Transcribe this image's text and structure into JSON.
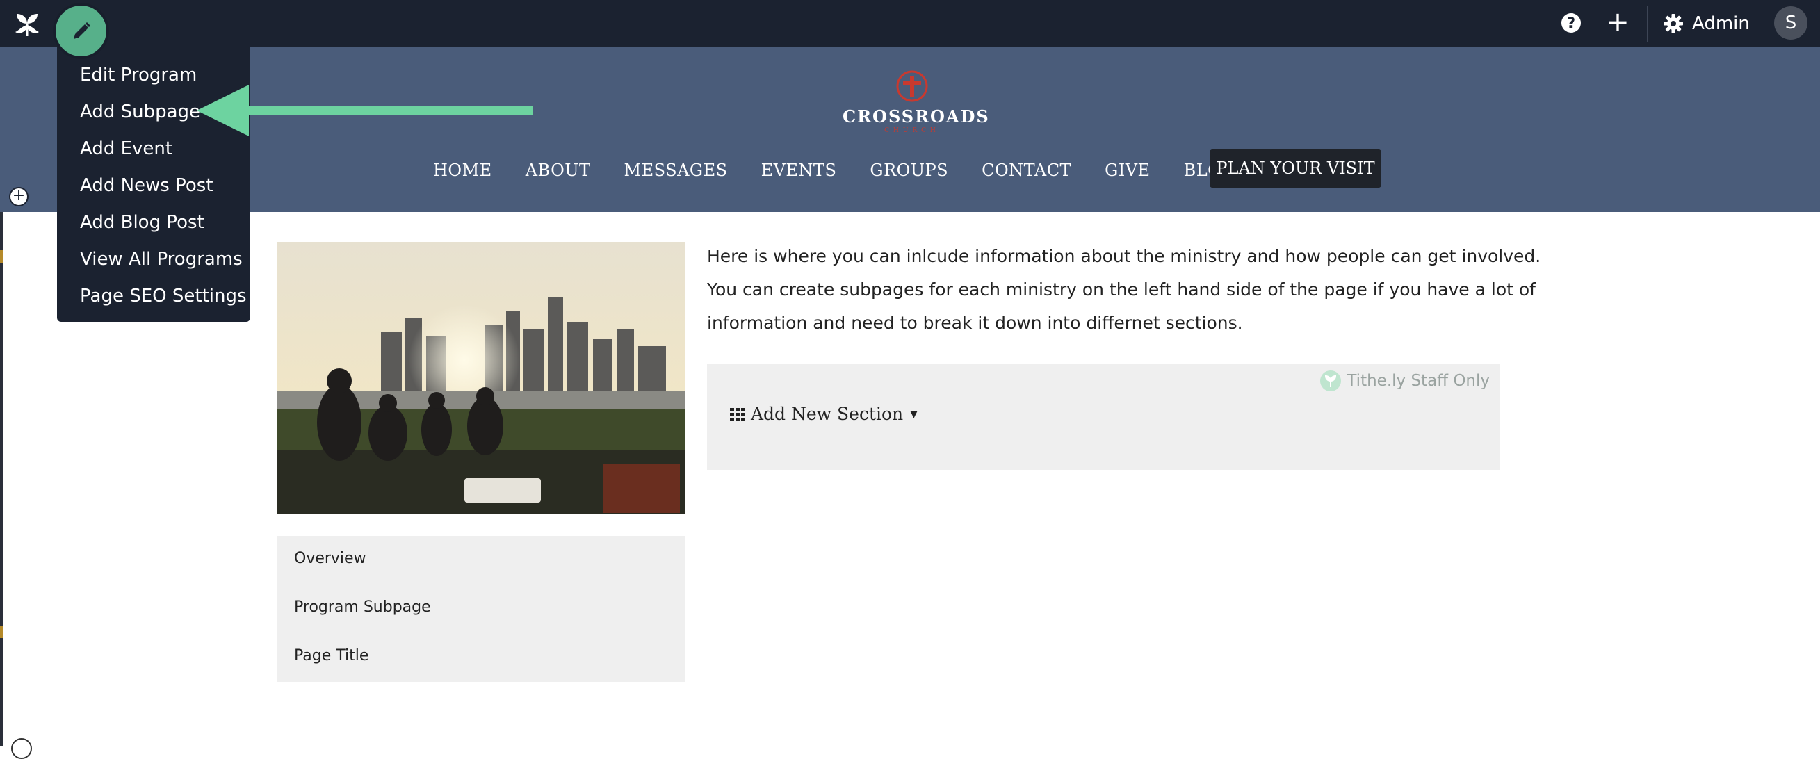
{
  "admin_bar": {
    "brand_icon": "leaf-sprout-icon",
    "help_label": "?",
    "add_label": "+",
    "admin_label": "Admin",
    "avatar_initial": "S"
  },
  "edit_menu": {
    "fab_icon": "pencil-icon",
    "items": [
      "Edit Program",
      "Add Subpage",
      "Add Event",
      "Add News Post",
      "Add Blog Post",
      "View All Programs",
      "Page SEO Settings"
    ]
  },
  "annotation": {
    "arrow_color": "#6dd3a0",
    "points_to": "Add Subpage"
  },
  "site": {
    "logo_name": "CROSSROADS",
    "logo_sub": "CHURCH",
    "nav": [
      "HOME",
      "ABOUT",
      "MESSAGES",
      "EVENTS",
      "GROUPS",
      "CONTACT",
      "GIVE",
      "BLOG"
    ],
    "cta": "PLAN YOUR VISIT",
    "header_color": "#4a5c7a",
    "brand_red": "#c8392f"
  },
  "content": {
    "body_text": "Here is where you can inlcude information about the ministry and how people can get involved. You can create subpages for each ministry on the left hand side of the page if you have a lot of information and need to break it down into differnet sections.",
    "staff_only_label": "Tithe.ly Staff Only",
    "add_section_label": "Add New Section",
    "subnav": [
      "Overview",
      "Program Subpage",
      "Page Title"
    ]
  }
}
